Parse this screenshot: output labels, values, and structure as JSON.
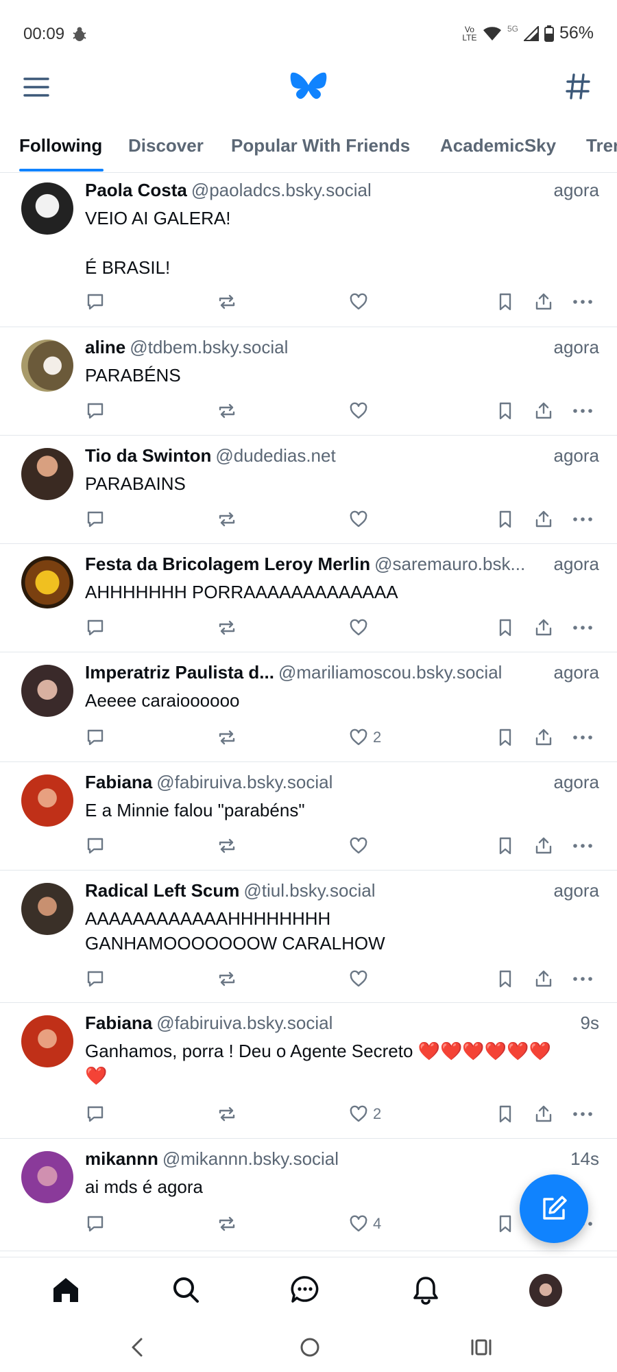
{
  "status_bar": {
    "time": "00:09",
    "network_label": "Vo LTE",
    "signal_label": "5G",
    "battery": "56%"
  },
  "header": {
    "menu_icon": "hamburger-menu-icon",
    "logo_icon": "butterfly-logo-icon",
    "feeds_icon": "hashtag-icon",
    "accent_color": "#1083fe"
  },
  "tabs": [
    {
      "label": "Following",
      "active": true
    },
    {
      "label": "Discover",
      "active": false
    },
    {
      "label": "Popular With Friends",
      "active": false
    },
    {
      "label": "AcademicSky",
      "active": false
    },
    {
      "label": "Trending",
      "active": false
    }
  ],
  "posts": [
    {
      "name": "Paola Costa",
      "handle": "@paoladcs.bsky.social",
      "time": "agora",
      "text": "VEIO AI GALERA!\n\nÉ BRASIL!",
      "likes": ""
    },
    {
      "name": "aline",
      "handle": "@tdbem.bsky.social",
      "time": "agora",
      "text": "PARABÉNS",
      "likes": ""
    },
    {
      "name": "Tio da Swinton",
      "handle": "@dudedias.net",
      "time": "agora",
      "text": "PARABAINS",
      "likes": ""
    },
    {
      "name": "Festa da Bricolagem Leroy Merlin",
      "handle": "@saremauro.bsk...",
      "time": "agora",
      "text": "AHHHHHHH PORRAAAAAAAAAAAAA",
      "likes": ""
    },
    {
      "name": "Imperatriz Paulista d...",
      "handle": "@mariliamoscou.bsky.social",
      "time": "agora",
      "text": "Aeeee caraioooooo",
      "likes": "2"
    },
    {
      "name": "Fabiana",
      "handle": "@fabiruiva.bsky.social",
      "time": "agora",
      "text": "E a Minnie falou \"parabéns\"",
      "likes": ""
    },
    {
      "name": "Radical Left Scum",
      "handle": "@tiul.bsky.social",
      "time": "agora",
      "text": "AAAAAAAAAAAAHHHHHHHH\nGANHAMOOOOOOOW CARALHOW",
      "likes": ""
    },
    {
      "name": "Fabiana",
      "handle": "@fabiruiva.bsky.social",
      "time": "9s",
      "text": "Ganhamos, porra ! Deu o Agente Secreto ❤️❤️❤️❤️❤️❤️\n❤️",
      "likes": "2"
    },
    {
      "name": "mikannn",
      "handle": "@mikannn.bsky.social",
      "time": "14s",
      "text": "ai mds é agora",
      "likes": "4"
    }
  ],
  "bottom_nav": [
    "home-icon",
    "search-icon",
    "chat-icon",
    "bell-icon",
    "profile-avatar"
  ],
  "compose_icon": "compose-icon"
}
